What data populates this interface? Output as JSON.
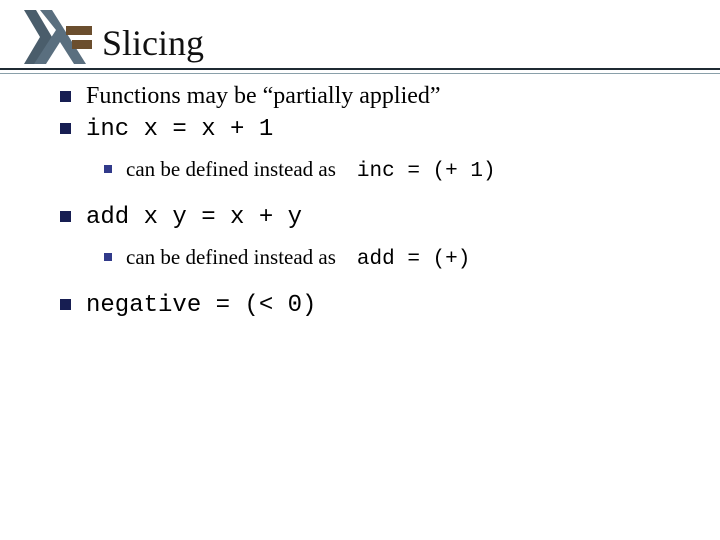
{
  "title": "Slicing",
  "items": [
    {
      "level": 1,
      "text": "Functions may be “partially applied”"
    },
    {
      "level": 1,
      "code": "inc x = x + 1"
    },
    {
      "level": 2,
      "text": "can be defined instead as",
      "code": "inc = (+ 1)"
    },
    {
      "level": 1,
      "code": "add x y = x + y"
    },
    {
      "level": 2,
      "text": "can be defined instead as",
      "code": "add = (+)"
    },
    {
      "level": 1,
      "code": "negative = (< 0)"
    }
  ]
}
